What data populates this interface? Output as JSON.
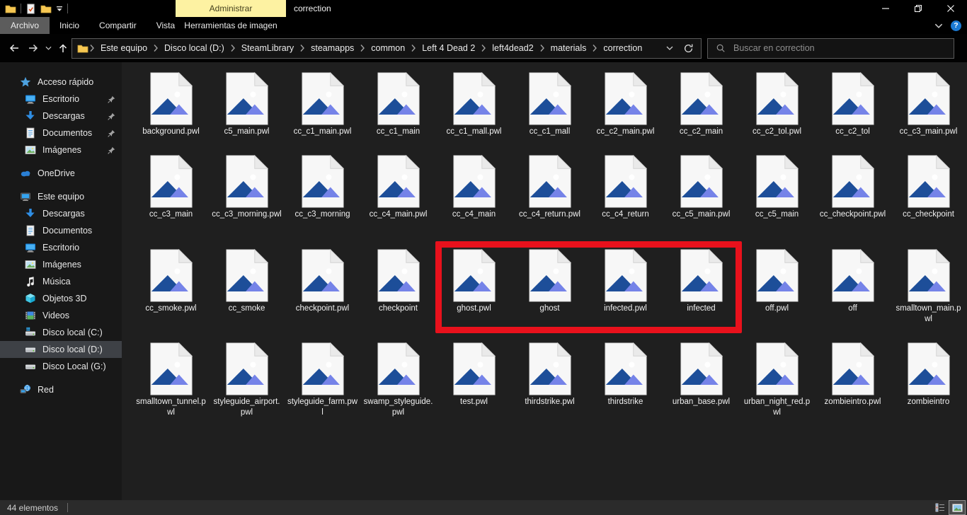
{
  "window": {
    "title": "correction",
    "context_tab_label": "Administrar",
    "titlebar_icons": [
      "explorer-folder-icon",
      "properties-check-icon",
      "new-folder-icon",
      "qat-dropdown-icon"
    ]
  },
  "ribbon": {
    "file_tab": "Archivo",
    "tabs": [
      "Inicio",
      "Compartir",
      "Vista"
    ],
    "tool_tab": "Herramientas de imagen",
    "help_label": "?",
    "right_icons": [
      "collapse-ribbon-chevron-icon",
      "help-icon"
    ]
  },
  "addressbar": {
    "nav_icons": [
      "back-icon",
      "forward-icon",
      "recent-locations-chevron-icon",
      "up-icon"
    ],
    "breadcrumb": [
      "Este equipo",
      "Disco local (D:)",
      "SteamLibrary",
      "steamapps",
      "common",
      "Left 4 Dead 2",
      "left4dead2",
      "materials",
      "correction"
    ],
    "box_icons": [
      "folder-icon",
      "address-dropdown-icon",
      "refresh-icon"
    ],
    "search_placeholder": "Buscar en correction",
    "search_icon": "search-icon"
  },
  "sidebar": {
    "items": [
      {
        "label": "Acceso rápido",
        "icon": "star",
        "level": 0
      },
      {
        "label": "Escritorio",
        "icon": "monitor",
        "level": 1,
        "pinned": true
      },
      {
        "label": "Descargas",
        "icon": "download",
        "level": 1,
        "pinned": true
      },
      {
        "label": "Documentos",
        "icon": "document",
        "level": 1,
        "pinned": true
      },
      {
        "label": "Imágenes",
        "icon": "picture",
        "level": 1,
        "pinned": true
      },
      {
        "label": "OneDrive",
        "icon": "cloud",
        "level": 0,
        "gap": true
      },
      {
        "label": "Este equipo",
        "icon": "computer",
        "level": 0,
        "gap": true
      },
      {
        "label": "Descargas",
        "icon": "download",
        "level": 1
      },
      {
        "label": "Documentos",
        "icon": "document",
        "level": 1
      },
      {
        "label": "Escritorio",
        "icon": "monitor",
        "level": 1
      },
      {
        "label": "Imágenes",
        "icon": "picture",
        "level": 1
      },
      {
        "label": "Música",
        "icon": "music",
        "level": 1
      },
      {
        "label": "Objetos 3D",
        "icon": "cube",
        "level": 1
      },
      {
        "label": "Videos",
        "icon": "film",
        "level": 1
      },
      {
        "label": "Disco local (C:)",
        "icon": "drive-os",
        "level": 1
      },
      {
        "label": "Disco local (D:)",
        "icon": "drive",
        "level": 1,
        "selected": true
      },
      {
        "label": "Disco Local (G:)",
        "icon": "drive",
        "level": 1
      },
      {
        "label": "Red",
        "icon": "network",
        "level": 0,
        "gap": true
      }
    ]
  },
  "files": {
    "icon": "image-file-icon",
    "items": [
      "background.pwl",
      "c5_main.pwl",
      "cc_c1_main.pwl",
      "cc_c1_main",
      "cc_c1_mall.pwl",
      "cc_c1_mall",
      "cc_c2_main.pwl",
      "cc_c2_main",
      "cc_c2_tol.pwl",
      "cc_c2_tol",
      "cc_c3_main.pwl",
      "cc_c3_main",
      "cc_c3_morning.pwl",
      "cc_c3_morning",
      "cc_c4_main.pwl",
      "cc_c4_main",
      "cc_c4_return.pwl",
      "cc_c4_return",
      "cc_c5_main.pwl",
      "cc_c5_main",
      "cc_checkpoint.pwl",
      "cc_checkpoint",
      "cc_smoke.pwl",
      "cc_smoke",
      "checkpoint.pwl",
      "checkpoint",
      "ghost.pwl",
      "ghost",
      "infected.pwl",
      "infected",
      "off.pwl",
      "off",
      "smalltown_main.pwl",
      "smalltown_tunnel.pwl",
      "styleguide_airport.pwl",
      "styleguide_farm.pwl",
      "swamp_styleguide.pwl",
      "test.pwl",
      "thirdstrike.pwl",
      "thirdstrike",
      "urban_base.pwl",
      "urban_night_red.pwl",
      "zombieintro.pwl",
      "zombieintro"
    ]
  },
  "annotation": {
    "color": "#e8111c",
    "highlighted_items": [
      "ghost.pwl",
      "ghost",
      "infected.pwl",
      "infected"
    ]
  },
  "statusbar": {
    "items_count": "44 elementos",
    "views": [
      "details-view",
      "thumbnails-view"
    ],
    "active_view": "thumbnails-view"
  },
  "colors": {
    "titlebar_bg": "#000000",
    "context_tab_bg": "#fdf2a2",
    "content_bg": "#1f1f1f",
    "sidebar_bg": "#181818",
    "statusbar_bg": "#2b2b2b",
    "annotation_red": "#e8111c",
    "help_blue": "#1b7ad3"
  }
}
